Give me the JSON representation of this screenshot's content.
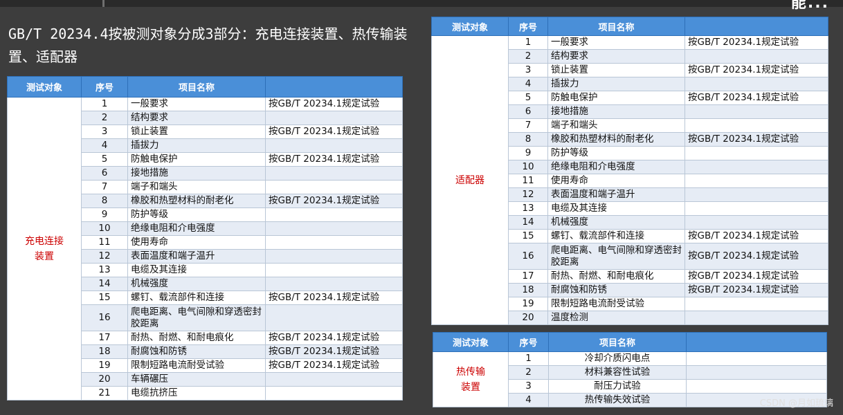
{
  "header": {
    "title": "能..."
  },
  "intro": "GB/T 20234.4按被测对象分成3部分：充电连接装置、热传输装置、适配器",
  "columns": {
    "object": "测试对象",
    "seq": "序号",
    "name": "项目名称",
    "remark": ""
  },
  "table1": {
    "object_line1": "充电连接",
    "object_line2": "装置",
    "rows": [
      {
        "seq": "1",
        "name": "一般要求",
        "remark": "按GB/T 20234.1规定试验"
      },
      {
        "seq": "2",
        "name": "结构要求",
        "remark": ""
      },
      {
        "seq": "3",
        "name": "锁止装置",
        "remark": "按GB/T 20234.1规定试验"
      },
      {
        "seq": "4",
        "name": "插拔力",
        "remark": ""
      },
      {
        "seq": "5",
        "name": "防触电保护",
        "remark": "按GB/T 20234.1规定试验"
      },
      {
        "seq": "6",
        "name": "接地措施",
        "remark": ""
      },
      {
        "seq": "7",
        "name": "端子和端头",
        "remark": ""
      },
      {
        "seq": "8",
        "name": "橡胶和热塑材料的耐老化",
        "remark": "按GB/T 20234.1规定试验"
      },
      {
        "seq": "9",
        "name": "防护等级",
        "remark": ""
      },
      {
        "seq": "10",
        "name": "绝缘电阻和介电强度",
        "remark": ""
      },
      {
        "seq": "11",
        "name": "使用寿命",
        "remark": ""
      },
      {
        "seq": "12",
        "name": "表面温度和端子温升",
        "remark": ""
      },
      {
        "seq": "13",
        "name": "电缆及其连接",
        "remark": ""
      },
      {
        "seq": "14",
        "name": "机械强度",
        "remark": ""
      },
      {
        "seq": "15",
        "name": "螺钉、载流部件和连接",
        "remark": "按GB/T 20234.1规定试验"
      },
      {
        "seq": "16",
        "name": "爬电距离、电气间隙和穿透密封胶距离",
        "remark": ""
      },
      {
        "seq": "17",
        "name": "耐热、耐燃、和耐电痕化",
        "remark": "按GB/T 20234.1规定试验"
      },
      {
        "seq": "18",
        "name": "耐腐蚀和防锈",
        "remark": "按GB/T 20234.1规定试验"
      },
      {
        "seq": "19",
        "name": "限制短路电流耐受试验",
        "remark": "按GB/T 20234.1规定试验"
      },
      {
        "seq": "20",
        "name": "车辆碾压",
        "remark": ""
      },
      {
        "seq": "21",
        "name": "电缆抗挤压",
        "remark": ""
      }
    ]
  },
  "table2": {
    "object": "适配器",
    "rows": [
      {
        "seq": "1",
        "name": "一般要求",
        "remark": "按GB/T 20234.1规定试验"
      },
      {
        "seq": "2",
        "name": "结构要求",
        "remark": ""
      },
      {
        "seq": "3",
        "name": "锁止装置",
        "remark": "按GB/T 20234.1规定试验"
      },
      {
        "seq": "4",
        "name": "插拔力",
        "remark": ""
      },
      {
        "seq": "5",
        "name": "防触电保护",
        "remark": "按GB/T 20234.1规定试验"
      },
      {
        "seq": "6",
        "name": "接地措施",
        "remark": ""
      },
      {
        "seq": "7",
        "name": "端子和端头",
        "remark": ""
      },
      {
        "seq": "8",
        "name": "橡胶和热塑材料的耐老化",
        "remark": "按GB/T 20234.1规定试验"
      },
      {
        "seq": "9",
        "name": "防护等级",
        "remark": ""
      },
      {
        "seq": "10",
        "name": "绝缘电阻和介电强度",
        "remark": ""
      },
      {
        "seq": "11",
        "name": "使用寿命",
        "remark": ""
      },
      {
        "seq": "12",
        "name": "表面温度和端子温升",
        "remark": ""
      },
      {
        "seq": "13",
        "name": "电缆及其连接",
        "remark": ""
      },
      {
        "seq": "14",
        "name": "机械强度",
        "remark": ""
      },
      {
        "seq": "15",
        "name": "螺钉、载流部件和连接",
        "remark": "按GB/T 20234.1规定试验"
      },
      {
        "seq": "16",
        "name": "爬电距离、电气间隙和穿透密封胶距离",
        "remark": "按GB/T 20234.1规定试验"
      },
      {
        "seq": "17",
        "name": "耐热、耐燃、和耐电痕化",
        "remark": "按GB/T 20234.1规定试验"
      },
      {
        "seq": "18",
        "name": "耐腐蚀和防锈",
        "remark": "按GB/T 20234.1规定试验"
      },
      {
        "seq": "19",
        "name": "限制短路电流耐受试验",
        "remark": ""
      },
      {
        "seq": "20",
        "name": "温度检测",
        "remark": ""
      }
    ]
  },
  "table3": {
    "object_line1": "热传输",
    "object_line2": "装置",
    "rows": [
      {
        "seq": "1",
        "name": "冷却介质闪电点",
        "remark": ""
      },
      {
        "seq": "2",
        "name": "材料兼容性试验",
        "remark": ""
      },
      {
        "seq": "3",
        "name": "耐压力试验",
        "remark": ""
      },
      {
        "seq": "4",
        "name": "热传输失效试验",
        "remark": ""
      }
    ]
  },
  "watermark": "CSDN @月如琉璃"
}
